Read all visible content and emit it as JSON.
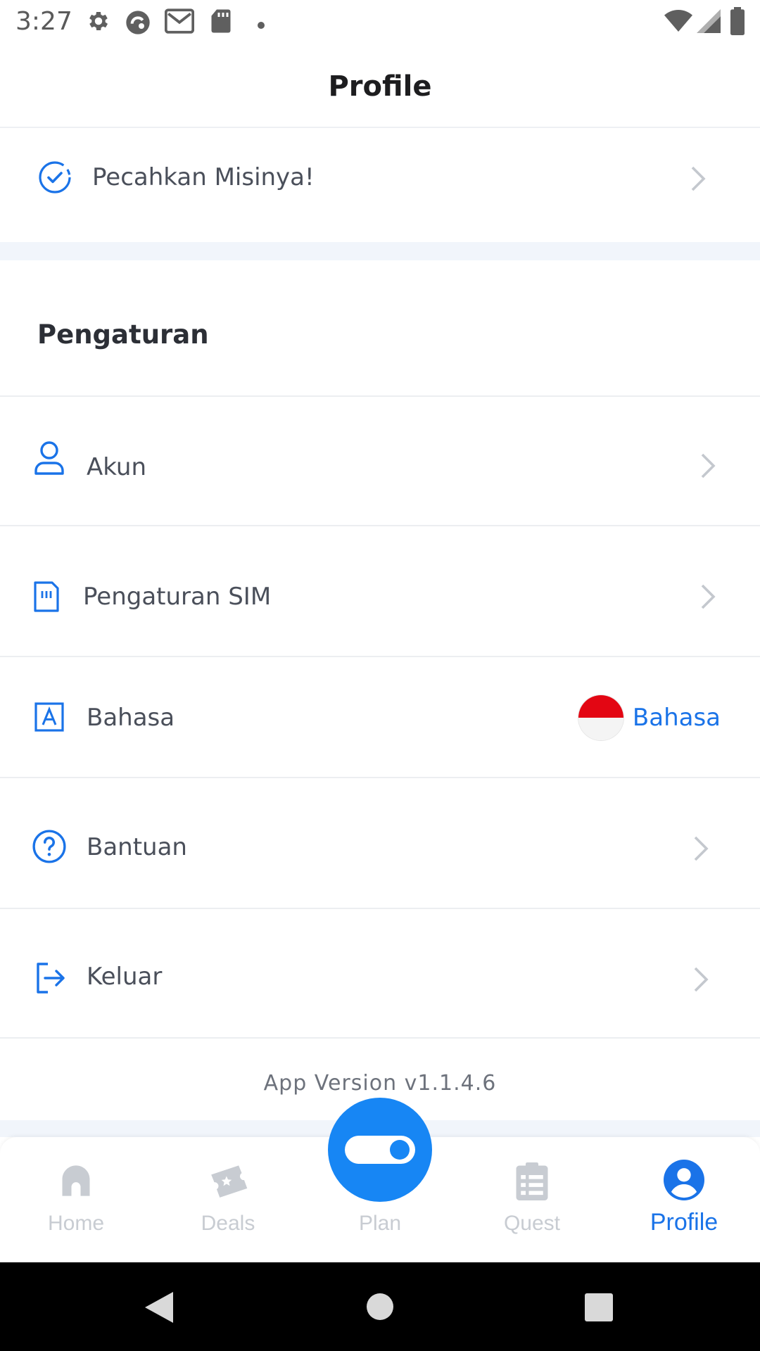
{
  "status_bar": {
    "time": "3:27",
    "left_icons": [
      "gear-icon",
      "app-circle-icon",
      "gmail-icon",
      "sd-card-icon",
      "dot-icon"
    ],
    "right_icons": [
      "wifi-icon",
      "signal-icon",
      "battery-icon"
    ]
  },
  "header": {
    "title": "Profile"
  },
  "mission": {
    "label": "Pecahkan Misinya!",
    "icon": "check-circle-icon"
  },
  "settings": {
    "section_title": "Pengaturan",
    "items": [
      {
        "label": "Akun",
        "icon": "user-icon"
      },
      {
        "label": "Pengaturan SIM",
        "icon": "sim-card-icon"
      },
      {
        "label": "Bahasa",
        "icon": "letter-a-icon",
        "value": "Bahasa",
        "flag": "indonesia-flag"
      },
      {
        "label": "Bantuan",
        "icon": "help-circle-icon"
      },
      {
        "label": "Keluar",
        "icon": "logout-icon"
      }
    ]
  },
  "app_version": "App Version v1.1.4.6",
  "bottom_nav": {
    "items": [
      {
        "label": "Home",
        "icon": "home-icon"
      },
      {
        "label": "Deals",
        "icon": "ticket-icon"
      },
      {
        "label": "Plan",
        "icon": "toggle-icon"
      },
      {
        "label": "Quest",
        "icon": "clipboard-icon"
      },
      {
        "label": "Profile",
        "icon": "profile-icon",
        "active": true
      }
    ]
  },
  "colors": {
    "accent": "#1a73e8",
    "fab": "#1786f4",
    "band": "#f1f5fb",
    "inactive_nav": "#c8ccd2"
  }
}
